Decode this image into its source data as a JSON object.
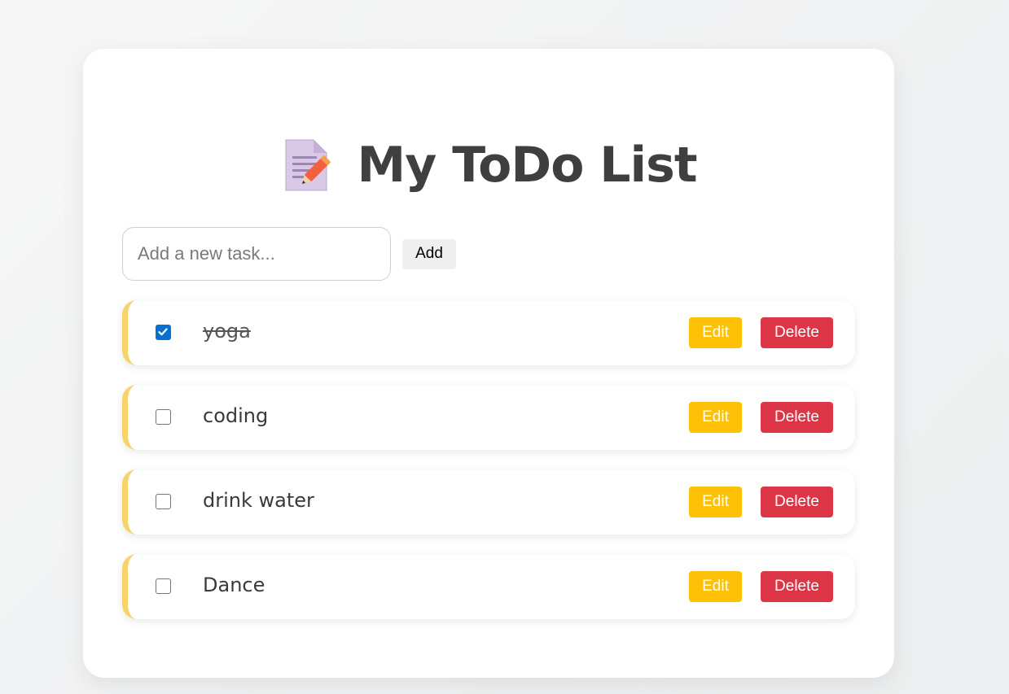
{
  "app": {
    "title": "My ToDo List",
    "title_icon": "memo-pencil-icon"
  },
  "add_form": {
    "input_value": "",
    "input_placeholder": "Add a new task...",
    "add_label": "Add"
  },
  "tasks": [
    {
      "text": "yoga",
      "done": true,
      "edit_label": "Edit",
      "delete_label": "Delete"
    },
    {
      "text": "coding",
      "done": false,
      "edit_label": "Edit",
      "delete_label": "Delete"
    },
    {
      "text": "drink water",
      "done": false,
      "edit_label": "Edit",
      "delete_label": "Delete"
    },
    {
      "text": "Dance",
      "done": false,
      "edit_label": "Edit",
      "delete_label": "Delete"
    }
  ],
  "colors": {
    "accent_border": "#f6d36b",
    "edit_button": "#ffc107",
    "delete_button": "#dc3545",
    "checkbox_checked": "#0b6fd0"
  }
}
